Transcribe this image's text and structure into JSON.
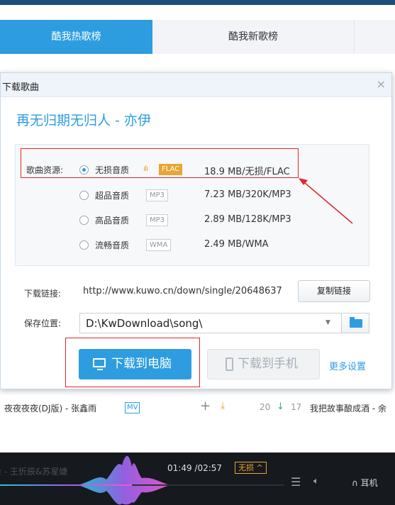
{
  "tabs": [
    {
      "label": "酷我热歌榜"
    },
    {
      "label": "酷我新歌榜"
    }
  ],
  "dialog": {
    "title": "下载歌曲",
    "song_title": "再无归期无归人 - 亦伊",
    "source_label": "歌曲资源:",
    "qualities": [
      {
        "name": "无损音质",
        "badge": "FLAC",
        "size": "18.9 MB/无损/FLAC",
        "selected": true
      },
      {
        "name": "超品音质",
        "badge": "MP3",
        "size": "7.23 MB/320K/MP3",
        "selected": false
      },
      {
        "name": "高品音质",
        "badge": "MP3",
        "size": "2.89 MB/128K/MP3",
        "selected": false
      },
      {
        "name": "流畅音质",
        "badge": "WMA",
        "size": "2.49 MB/WMA",
        "selected": false
      }
    ],
    "link_label": "下载链接:",
    "link_url": "http://www.kuwo.cn/down/single/20648637",
    "copy_button": "复制链接",
    "save_label": "保存位置:",
    "save_path": "D:\\KwDownload\\song\\",
    "download_pc": "下载到电脑",
    "download_phone": "下载到手机",
    "more_settings": "更多设置"
  },
  "song_row": {
    "title": "夜夜夜夜(DJ版) - 张鑫雨",
    "mv": "MV",
    "rank": "20",
    "change": "17",
    "next": "我把故事酿成酒 - 余"
  },
  "player": {
    "song": "余 - 王忻辰&苏星婕",
    "time": "01:49 /02:57",
    "quality": "无损 ^",
    "earphone": "耳机",
    "progress": 0.62
  },
  "colors": {
    "accent": "#2d9de0",
    "highlight": "#e3262d",
    "flac": "#e6a534"
  }
}
